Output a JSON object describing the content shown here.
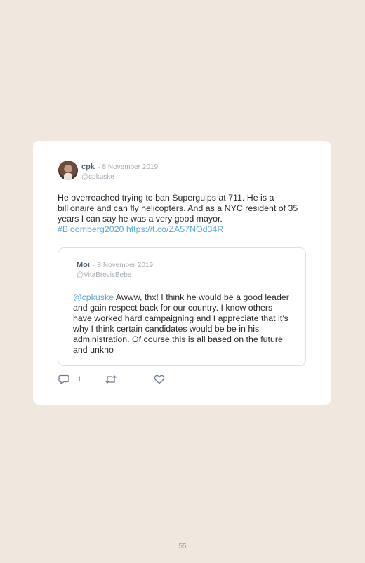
{
  "tweet": {
    "name": "cpk",
    "date": "· 8 November 2019",
    "handle": "@cpkuske",
    "text": "He overreached trying to ban Supergulps at 711. He is a billionaire and can fly helicopters. And as a NYC resident of 35 years I can say he was a very good mayor.",
    "hashtag": "#Bloomberg2020",
    "url": "https://t.co/ZA57NOd34R",
    "reply_count": "1"
  },
  "quoted": {
    "name": "Moi",
    "date": "· 8 November 2019",
    "handle": "@VitaBrevisBebe",
    "mention": "@cpkuske",
    "text": " Awww, thx! I think he would be a good leader and gain respect back for our country. I know others have worked hard campaigning and I appreciate that it's why I think certain candidates would be be in his administration. Of course,this is all based on the future and unkno"
  },
  "icons": {
    "reply": "reply-icon",
    "retweet": "retweet-icon",
    "like": "heart-icon"
  },
  "page": {
    "number": "55"
  }
}
